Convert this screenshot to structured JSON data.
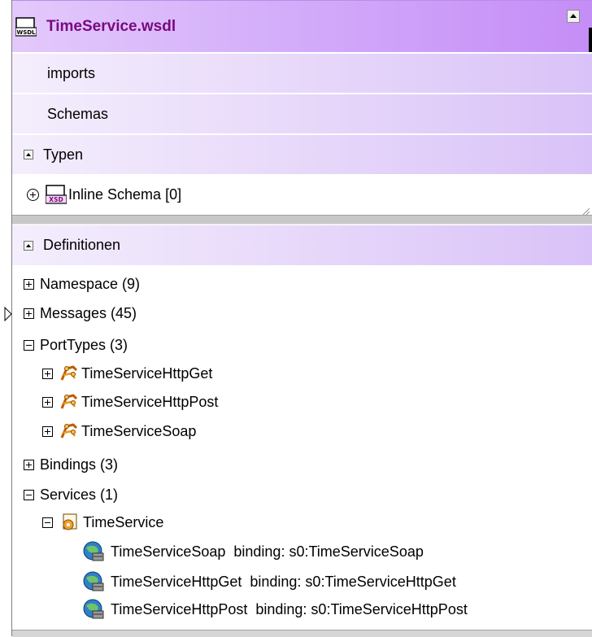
{
  "window": {
    "title": "TimeService.wsdl",
    "title_icon": "wsdl-file-icon"
  },
  "sections": {
    "imports_label": "imports",
    "schemas_label": "Schemas",
    "typen_label": "Typen",
    "inline_schema_label": "Inline Schema [0]",
    "definitionen_label": "Definitionen"
  },
  "tree": {
    "namespace": "Namespace (9)",
    "messages": "Messages (45)",
    "porttypes": "PortTypes (3)",
    "porttype_items": [
      "TimeServiceHttpGet",
      "TimeServiceHttpPost",
      "TimeServiceSoap"
    ],
    "bindings": "Bindings (3)",
    "services": "Services (1)",
    "service_name": "TimeService",
    "ports": [
      "TimeServiceSoap  binding: s0:TimeServiceSoap",
      "TimeServiceHttpGet  binding: s0:TimeServiceHttpGet",
      "TimeServiceHttpPost  binding: s0:TimeServiceHttpPost"
    ]
  },
  "colors": {
    "title_text": "#7a0a80",
    "title_gradient_end": "#c58df7",
    "band_gradient_end": "#d9c2f8"
  }
}
